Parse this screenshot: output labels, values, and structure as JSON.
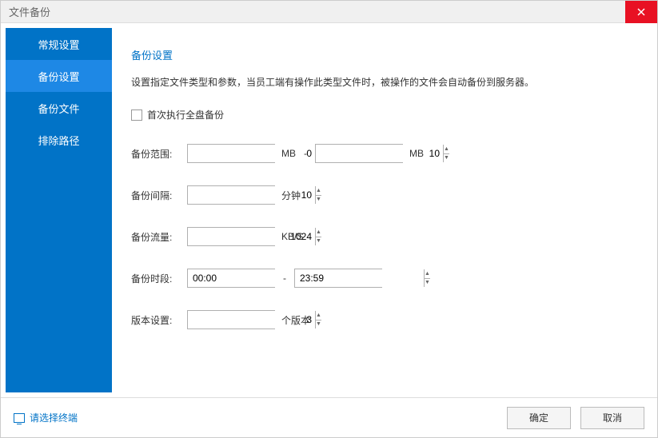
{
  "window": {
    "title": "文件备份"
  },
  "sidebar": {
    "items": [
      {
        "label": "常规设置"
      },
      {
        "label": "备份设置"
      },
      {
        "label": "备份文件"
      },
      {
        "label": "排除路径"
      }
    ]
  },
  "main": {
    "section_title": "备份设置",
    "section_desc": "设置指定文件类型和参数，当员工端有操作此类型文件时，被操作的文件会自动备份到服务器。",
    "checkbox_label": "首次执行全盘备份",
    "range": {
      "label": "备份范围:",
      "from": "0",
      "to": "10",
      "unit": "MB",
      "dash": "-"
    },
    "interval": {
      "label": "备份间隔:",
      "value": "10",
      "unit": "分钟"
    },
    "traffic": {
      "label": "备份流量:",
      "value": "1024",
      "unit": "KB/S"
    },
    "timespan": {
      "label": "备份时段:",
      "from": "00:00",
      "to": "23:59",
      "dash": "-"
    },
    "version": {
      "label": "版本设置:",
      "value": "3",
      "unit": "个版本"
    }
  },
  "footer": {
    "select_terminal": "请选择终端",
    "ok": "确定",
    "cancel": "取消"
  }
}
